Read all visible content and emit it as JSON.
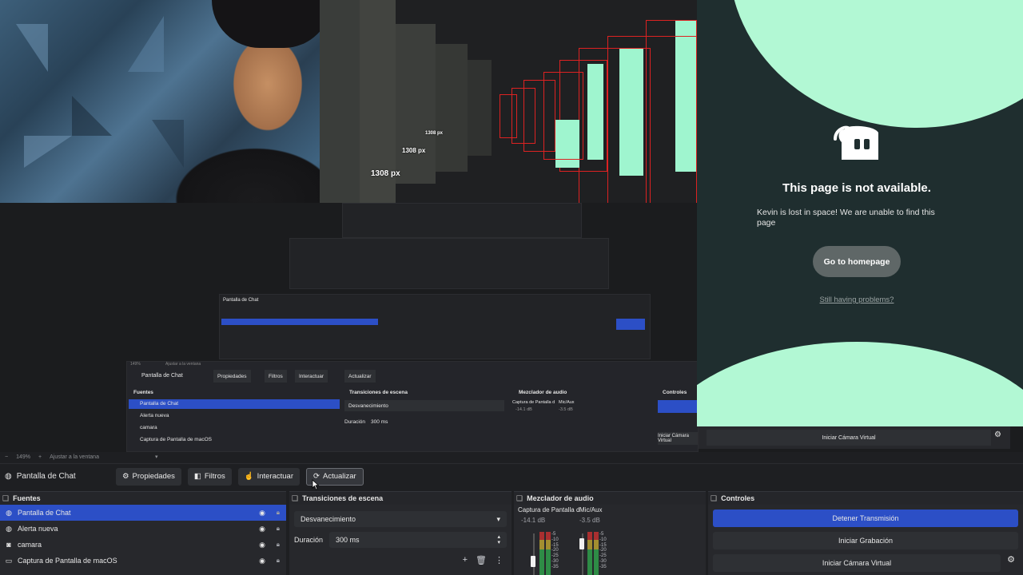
{
  "preview": {
    "px_labels": [
      "1308 px",
      "1308 px",
      "1308 px"
    ],
    "nested_scene_label": "Pantalla de Chat",
    "nested_buttons": [
      "Propiedades",
      "Filtros",
      "Interactuar",
      "Actualizar"
    ],
    "nested_dock_headers": [
      "Fuentes",
      "Transiciones de escena",
      "Mezclador de audio",
      "Controles"
    ],
    "nested_sources": [
      "Pantalla de Chat",
      "Alerta nueva",
      "camara",
      "Captura de Pantalla de macOS"
    ],
    "nested_transition": "Desvanecimiento",
    "nested_duration_label": "Duración",
    "nested_duration_value": "300 ms",
    "nested_mixer_channels": [
      "Captura de Pantalla d",
      "Mic/Aux"
    ],
    "nested_mixer_db": [
      "-14.1 dB",
      "-3.5 dB"
    ],
    "nested_zoom": "149%",
    "nested_fit": "Ajustar a la ventana",
    "nested_virtual_cam": "Iniciar Cámara Virtual"
  },
  "error_page": {
    "title": "This page is not available.",
    "message": "Kevin is lost in space! We are unable to find this page",
    "button": "Go to homepage",
    "link": "Still having problems?",
    "colors": {
      "background": "#1f2e2f",
      "blob": "#b2f8d4"
    }
  },
  "zoom_bar": {
    "minus": "−",
    "zoom": "149%",
    "plus": "+",
    "fit": "Ajustar a la ventana",
    "arrow": "▾"
  },
  "toolbar": {
    "scene": "Pantalla de Chat",
    "properties": "Propiedades",
    "filters": "Filtros",
    "interact": "Interactuar",
    "refresh": "Actualizar"
  },
  "sources": {
    "title": "Fuentes",
    "items": [
      {
        "label": "Pantalla de Chat",
        "icon": "globe-icon",
        "selected": true
      },
      {
        "label": "Alerta nueva",
        "icon": "globe-icon",
        "selected": false
      },
      {
        "label": "camara",
        "icon": "camera-icon",
        "selected": false
      },
      {
        "label": "Captura de Pantalla de macOS",
        "icon": "monitor-icon",
        "selected": false
      }
    ]
  },
  "transitions": {
    "title": "Transiciones de escena",
    "selected": "Desvanecimiento",
    "duration_label": "Duración",
    "duration_value": "300 ms"
  },
  "mixer": {
    "title": "Mezclador de audio",
    "channels": [
      {
        "name": "Captura de Pantalla d",
        "db": "-14.1 dB"
      },
      {
        "name": "Mic/Aux",
        "db": "-3.5 dB"
      }
    ],
    "ticks": [
      "-5",
      "-10",
      "-15",
      "-20",
      "-25",
      "-30",
      "-35"
    ]
  },
  "controls": {
    "title": "Controles",
    "stop_stream": "Detener Transmisión",
    "start_recording": "Iniciar Grabación",
    "virtual_cam": "Iniciar Cámara Virtual",
    "accent": "#2c4fc6"
  }
}
